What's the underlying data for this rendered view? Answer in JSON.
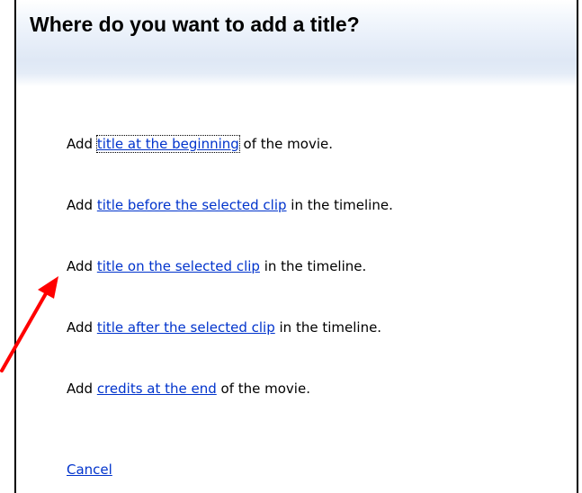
{
  "dialog": {
    "title": "Where do you want to add a title?"
  },
  "options": [
    {
      "prefix": "Add ",
      "link": "title at the beginning",
      "suffix": " of the movie."
    },
    {
      "prefix": "Add ",
      "link": "title before the selected clip",
      "suffix": " in the timeline."
    },
    {
      "prefix": "Add ",
      "link": "title on the selected clip",
      "suffix": " in the timeline."
    },
    {
      "prefix": "Add ",
      "link": "title after the selected clip",
      "suffix": " in the timeline."
    },
    {
      "prefix": "Add ",
      "link": "credits at the end",
      "suffix": " of the movie."
    }
  ],
  "cancel_label": "Cancel",
  "colors": {
    "link": "#0033cc",
    "annotation_arrow": "#ff0000",
    "header_gradient": "#dfe8f5"
  },
  "icons": {
    "annotation": "red-arrow"
  }
}
